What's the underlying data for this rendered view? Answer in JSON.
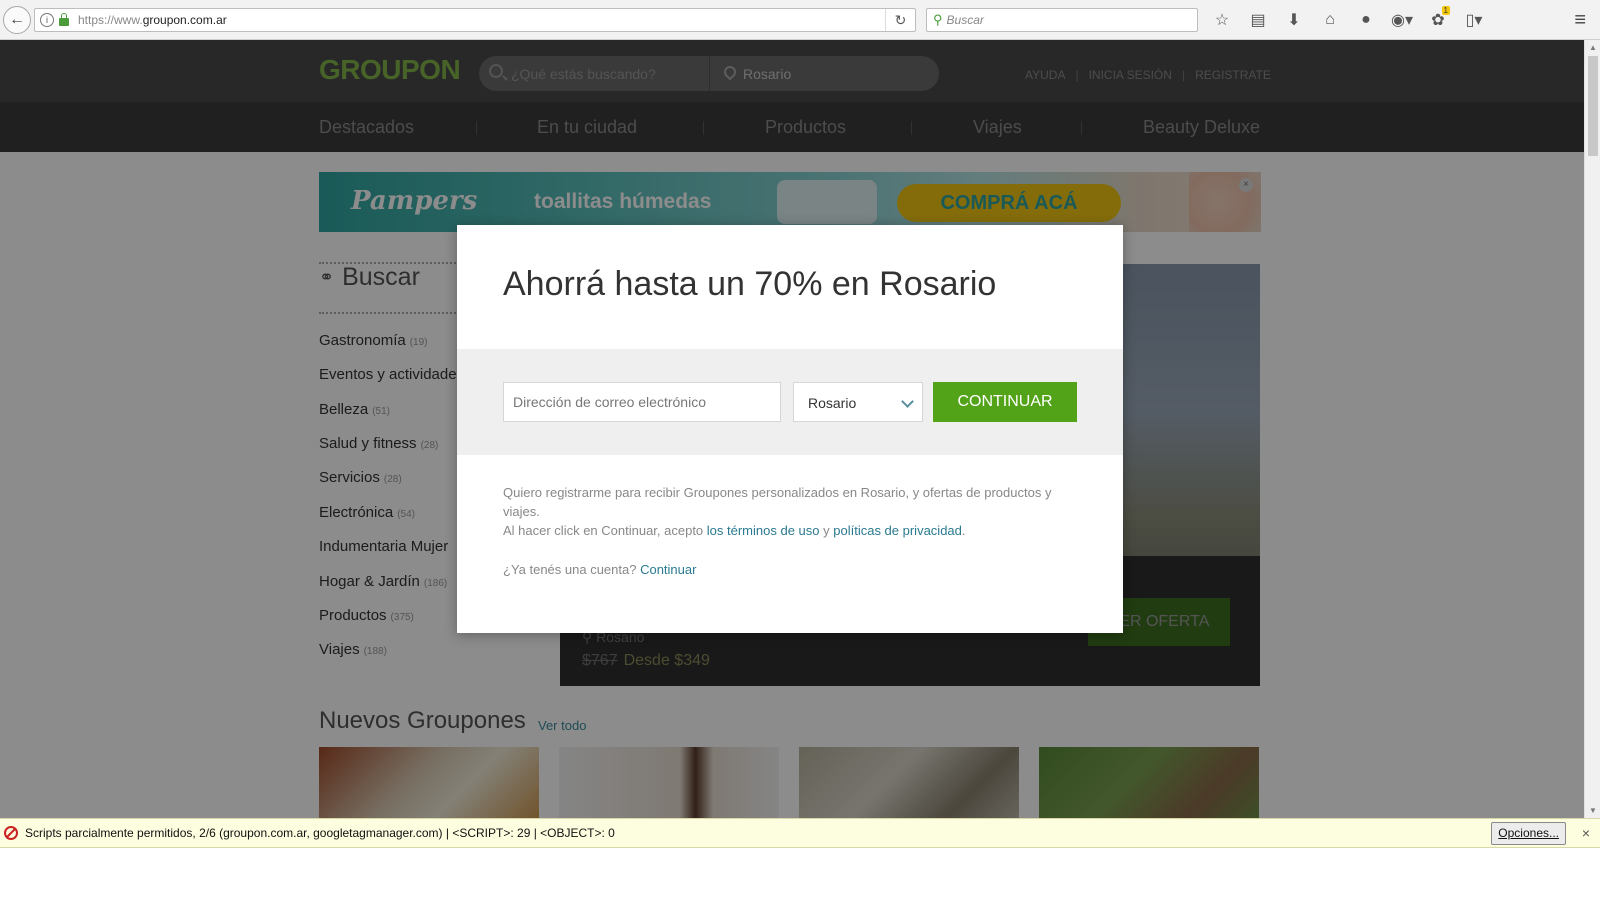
{
  "browser": {
    "url_prefix": "https://www.",
    "url_domain": "groupon.com.ar",
    "search_placeholder": "Buscar",
    "reload_glyph": "↻",
    "back_glyph": "←",
    "badge_count": "1",
    "info_glyph": "i"
  },
  "header": {
    "logo": "GROUPON",
    "search_placeholder": "¿Qué estás buscando?",
    "location": "Rosario",
    "links": [
      "AYUDA",
      "INICIA SESIÓN",
      "REGISTRATE"
    ]
  },
  "nav": {
    "items": [
      "Destacados",
      "En tu ciudad",
      "Productos",
      "Viajes",
      "Beauty Deluxe"
    ]
  },
  "banner": {
    "brand": "Pampers",
    "tagline": "toallitas húmedas",
    "cta": "COMPRÁ ACÁ",
    "close": "×"
  },
  "sidebar": {
    "title": "Buscar",
    "categories": [
      {
        "label": "Gastronomía",
        "count": "(19)"
      },
      {
        "label": "Eventos y actividades",
        "count": ""
      },
      {
        "label": "Belleza",
        "count": "(51)"
      },
      {
        "label": "Salud y fitness",
        "count": "(28)"
      },
      {
        "label": "Servicios",
        "count": "(28)"
      },
      {
        "label": "Electrónica",
        "count": "(54)"
      },
      {
        "label": "Indumentaria Mujer",
        "count": ""
      },
      {
        "label": "Hogar & Jardín",
        "count": "(186)"
      },
      {
        "label": "Productos",
        "count": "(375)"
      },
      {
        "label": "Viajes",
        "count": "(188)"
      }
    ]
  },
  "feature": {
    "location": "Rosario",
    "old_price": "$767",
    "price": "Desde $349",
    "button": "VER OFERTA"
  },
  "new_deals": {
    "title": "Nuevos Groupones",
    "link": "Ver todo"
  },
  "modal": {
    "title": "Ahorrá hasta un 70% en Rosario",
    "email_placeholder": "Dirección de correo electrónico",
    "city": "Rosario",
    "continue_label": "CONTINUAR",
    "consent_text": "Quiero registrarme para recibir Groupones personalizados en Rosario, y ofertas de productos y viajes.",
    "terms_prefix": "Al hacer click en Continuar, acepto ",
    "terms_link": "los términos de uso",
    "terms_and": " y ",
    "privacy_link": "políticas de privacidad",
    "terms_suffix": ".",
    "account_question": "¿Ya tenés una cuenta? ",
    "account_link": "Continuar"
  },
  "notification": {
    "message": "Scripts parcialmente permitidos, 2/6 (groupon.com.ar, googletagmanager.com) | <SCRIPT>: 29 | <OBJECT>: 0",
    "options_label": "Opciones...",
    "close": "×"
  },
  "colors": {
    "groupon_green": "#82b548",
    "button_green": "#53a318",
    "link_blue": "#2a7a90"
  }
}
